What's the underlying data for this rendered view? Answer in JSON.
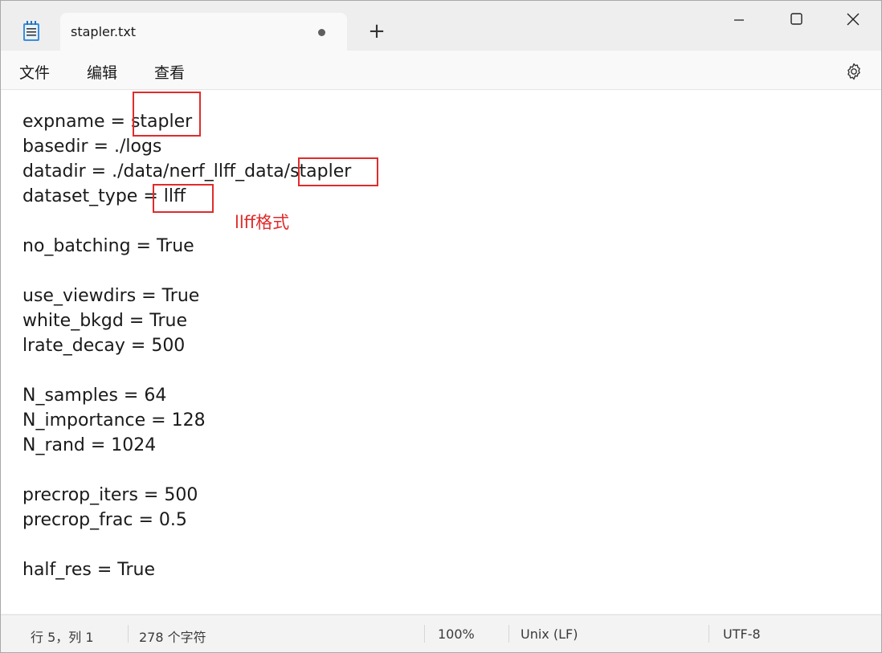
{
  "tab": {
    "title": "stapler.txt",
    "new_tab_label": "+"
  },
  "menu": {
    "file": "文件",
    "edit": "编辑",
    "view": "查看"
  },
  "editor": {
    "lines": [
      "expname = stapler",
      "basedir = ./logs",
      "datadir = ./data/nerf_llff_data/stapler",
      "dataset_type = llff",
      "",
      "no_batching = True",
      "",
      "use_viewdirs = True",
      "white_bkgd = True",
      "lrate_decay = 500",
      "",
      "N_samples = 64",
      "N_importance = 128",
      "N_rand = 1024",
      "",
      "precrop_iters = 500",
      "precrop_frac = 0.5",
      "",
      "half_res = True"
    ],
    "annotation": "llff格式",
    "highlight_color": "#e02b2b"
  },
  "status": {
    "position": "行 5，列 1",
    "char_count": "278 个字符",
    "zoom": "100%",
    "line_ending": "Unix (LF)",
    "encoding": "UTF-8"
  }
}
